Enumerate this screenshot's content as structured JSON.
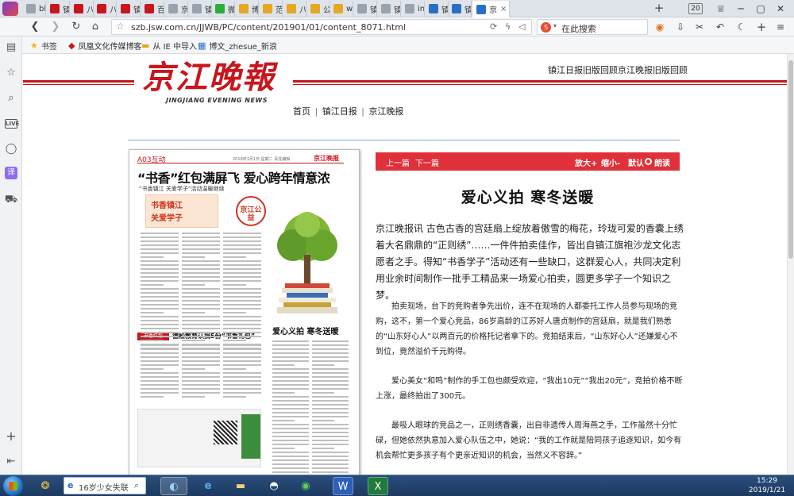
{
  "tabs": [
    {
      "label": "bl",
      "fav": "globe",
      "color": "#9aa3ad"
    },
    {
      "label": "镇",
      "fav": "pic",
      "color": "#c8161d"
    },
    {
      "label": "八",
      "fav": "pic",
      "color": "#c8161d"
    },
    {
      "label": "八",
      "fav": "pic",
      "color": "#c8161d"
    },
    {
      "label": "镇",
      "fav": "pic",
      "color": "#c8161d"
    },
    {
      "label": "百",
      "fav": "pic",
      "color": "#c8161d"
    },
    {
      "label": "京",
      "fav": "globe",
      "color": "#9aa3ad"
    },
    {
      "label": "镇",
      "fav": "globe",
      "color": "#9aa3ad"
    },
    {
      "label": "微",
      "fav": "wechat",
      "color": "#2aae3a"
    },
    {
      "label": "博",
      "fav": "img",
      "color": "#e5a823"
    },
    {
      "label": "范",
      "fav": "img",
      "color": "#e5a823"
    },
    {
      "label": "八",
      "fav": "img",
      "color": "#e5a823"
    },
    {
      "label": "公",
      "fav": "img",
      "color": "#e5a823"
    },
    {
      "label": "wi",
      "fav": "ie",
      "color": "#e5a823"
    },
    {
      "label": "镇",
      "fav": "globe",
      "color": "#9aa3ad"
    },
    {
      "label": "镇",
      "fav": "globe",
      "color": "#9aa3ad"
    },
    {
      "label": "in",
      "fav": "globe",
      "color": "#9aa3ad"
    },
    {
      "label": "镇",
      "fav": "arrow",
      "color": "#2a6fc7"
    },
    {
      "label": "镇",
      "fav": "arrow",
      "color": "#2a6fc7"
    },
    {
      "label": "京",
      "fav": "arrow",
      "color": "#2a6fc7",
      "active": true
    }
  ],
  "tab_count": "20",
  "address": {
    "url": "szb.jsw.com.cn/JJWB/PC/content/201901/01/content_8071.html",
    "search_placeholder": "在此搜索"
  },
  "bookmarks": [
    {
      "label": "书签",
      "icon": "★"
    },
    {
      "label": "凤凰文化传媒博客",
      "icon": "◆"
    },
    {
      "label": "从 IE 中导入",
      "icon": "▬"
    },
    {
      "label": "博文_zhesue_新浪",
      "icon": "▦"
    }
  ],
  "site": {
    "logo_cn": "京江晚報",
    "logo_en": "JINGJIANG EVENING NEWS",
    "top_link_1": "镇江日报旧版回顾",
    "top_link_2": "京江晚报旧版回顾",
    "nav_home": "首页",
    "nav_zjrb": "镇江日报",
    "nav_jjwb": "京江晚报",
    "nav_sep": "|"
  },
  "paper": {
    "edition": "A03互动",
    "date_line": "2019年1月1日 星期二 责任编辑",
    "brand": "京江晚报",
    "headline": "“书香”红包满屏飞 爱心跨年情意浓",
    "subhead": "“书香镇江 关爱学子”活动温暖继续",
    "graphic_1": "书香镇江",
    "graphic_2": "关爱学子",
    "badge": "京江公益",
    "caption": "爱心义拍 寒冬送暖",
    "section_tag": "书香红包",
    "section_title": "德松教育认捐5份“书香礼包”"
  },
  "article": {
    "prev": "上一篇",
    "next": "下一篇",
    "zoom_in": "放大+",
    "zoom_out": "缩小-",
    "default": "默认",
    "read_aloud": "朗读",
    "title": "爱心义拍 寒冬送暖",
    "lead": "京江晚报讯 古色古香的宫廷扇上绽放着傲雪的梅花，玲珑可爱的香囊上绣着大名鼎鼎的“正则绣”……一件件拍卖佳作，皆出自镇江旗袍沙龙文化志愿者之手。得知“书香学子”活动还有一些缺口，这群爱心人，共同决定利用业余时间制作一批手工精品来一场爱心拍卖，圆更多学子一个知识之梦。",
    "paragraphs": [
      "拍卖现场，台下的竞购者争先出价，连不在现场的人都委托工作人员参与现场的竞购，这不，第一个爱心竞品，86岁高龄的江苏好人唐贞制作的宫廷扇，就是我们熟悉的“山东好心人”以两百元的价格托记者拿下的。竞拍结束后，“山东好心人”还嫌爱心不到位，竟然溢价千元购得。",
      "爱心美女“和鸣”制作的手工包也颇受欢迎，“我出10元”“我出20元”，竞拍价格不断上涨，最终拍出了300元。",
      "最吸人眼球的竞品之一，正则绣香囊，出自非遗传人周海燕之手，工作虽然十分忙碌，但她依然执意加入爱心队伍之中，她说：“我的工作就是陪同孩子追逐知识，如今有机会帮忙更多孩子有个更亲近知识的机会，当然义不容辞。”"
    ]
  },
  "taskbar": {
    "search_text": "16岁少女失联",
    "time": "15:29",
    "date": "2019/1/21"
  },
  "colors": {
    "brand_red": "#c8161d",
    "bar_red": "#e0313a",
    "rule_blue": "#8aa6c2"
  }
}
